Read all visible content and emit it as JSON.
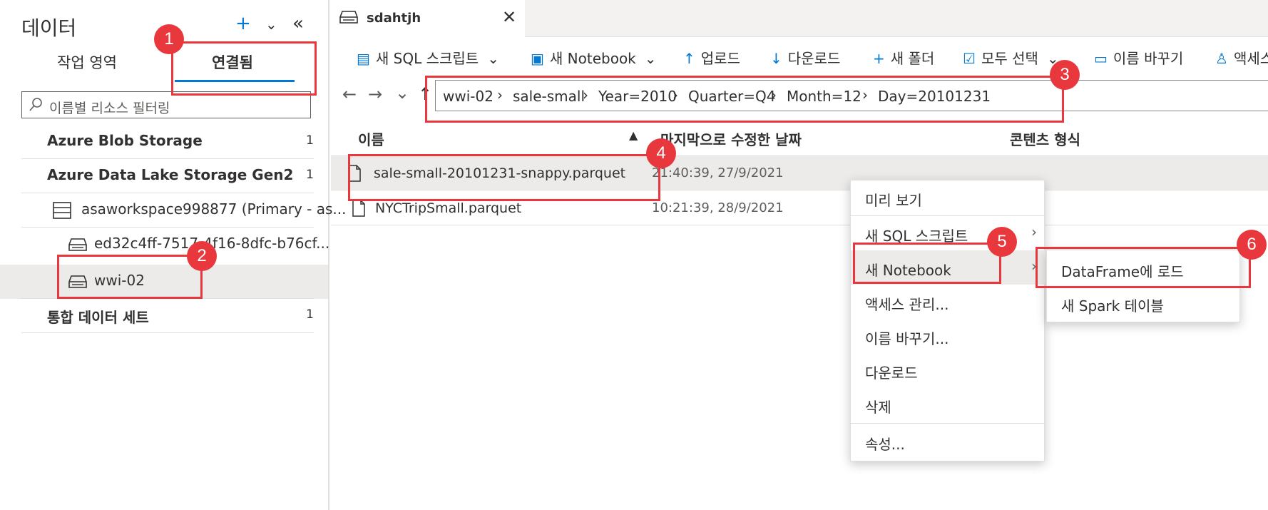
{
  "left": {
    "title": "데이터",
    "tabs": [
      "작업 영역",
      "연결됨"
    ],
    "filter_placeholder": "이름별 리소스 필터링",
    "tree": [
      {
        "label": "Azure Blob Storage",
        "count": "1"
      },
      {
        "label": "Azure Data Lake Storage Gen2",
        "count": "1"
      },
      {
        "label": "asaworkspace998877 (Primary - as..."
      },
      {
        "label": "ed32c4ff-7517-4f16-8dfc-b76cf..."
      },
      {
        "label": "wwi-02"
      },
      {
        "label": "통합 데이터 세트",
        "count": "1"
      }
    ]
  },
  "doc_tab": {
    "name": "sdahtjh",
    "close": "✕"
  },
  "toolbar": {
    "new_sql": "새 SQL 스크립트",
    "new_notebook": "새 Notebook",
    "upload": "업로드",
    "download": "다운로드",
    "new_folder": "새 폴더",
    "select_all": "모두 선택",
    "rename": "이름 바꾸기",
    "access": "액세스"
  },
  "breadcrumb": [
    "wwi-02",
    "sale-small",
    "Year=2010",
    "Quarter=Q4",
    "Month=12",
    "Day=20101231"
  ],
  "columns": {
    "name": "이름",
    "modified": "마지막으로 수정한 날짜",
    "content_type": "콘텐츠 형식"
  },
  "files": [
    {
      "name": "sale-small-20101231-snappy.parquet",
      "date": "21:40:39, 27/9/2021"
    },
    {
      "name": "NYCTripSmall.parquet",
      "date": "10:21:39, 28/9/2021"
    }
  ],
  "context_menu": {
    "preview": "미리 보기",
    "new_sql": "새 SQL 스크립트",
    "new_notebook": "새 Notebook",
    "manage_access": "액세스 관리...",
    "rename": "이름 바꾸기...",
    "download": "다운로드",
    "delete": "삭제",
    "properties": "속성..."
  },
  "submenu": {
    "load_dataframe": "DataFrame에 로드",
    "new_spark_table": "새 Spark 테이블"
  },
  "badges": [
    "1",
    "2",
    "3",
    "4",
    "5",
    "6"
  ]
}
